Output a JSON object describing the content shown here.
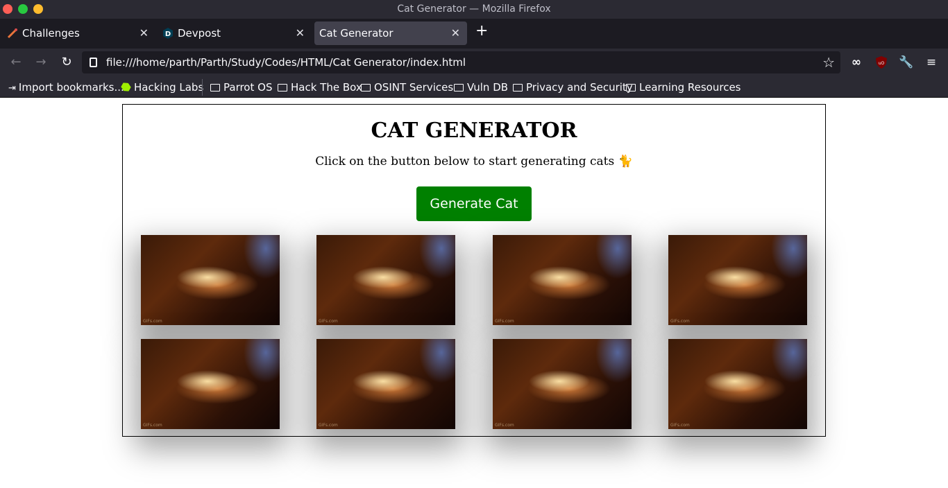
{
  "window": {
    "title": "Cat Generator — Mozilla Firefox"
  },
  "tabs": [
    {
      "label": "Challenges",
      "icon": "challenges-icon"
    },
    {
      "label": "Devpost",
      "icon": "devpost-icon"
    },
    {
      "label": "Cat Generator",
      "active": true
    }
  ],
  "navbar": {
    "url": "file:///home/parth/Parth/Study/Codes/HTML/Cat Generator/index.html"
  },
  "bookmarks": [
    {
      "label": "Import bookmarks...",
      "icon": "import-icon"
    },
    {
      "label": "Hacking Labs",
      "icon": "hackthebox-icon"
    },
    {
      "label": "Parrot OS",
      "icon": "folder-icon"
    },
    {
      "label": "Hack The Box",
      "icon": "folder-icon"
    },
    {
      "label": "OSINT Services",
      "icon": "folder-icon"
    },
    {
      "label": "Vuln DB",
      "icon": "folder-icon"
    },
    {
      "label": "Privacy and Security",
      "icon": "folder-icon"
    },
    {
      "label": "Learning Resources",
      "icon": "folder-icon"
    }
  ],
  "page": {
    "heading": "CAT GENERATOR",
    "subtitle": "Click on the button below to start generating cats 🐈",
    "button_label": "Generate Cat",
    "cat_watermark": "GIFs.com",
    "cat_count": 8
  },
  "colors": {
    "button": "#008000",
    "chrome": "#2b2a33",
    "tabstrip": "#1c1b22"
  }
}
